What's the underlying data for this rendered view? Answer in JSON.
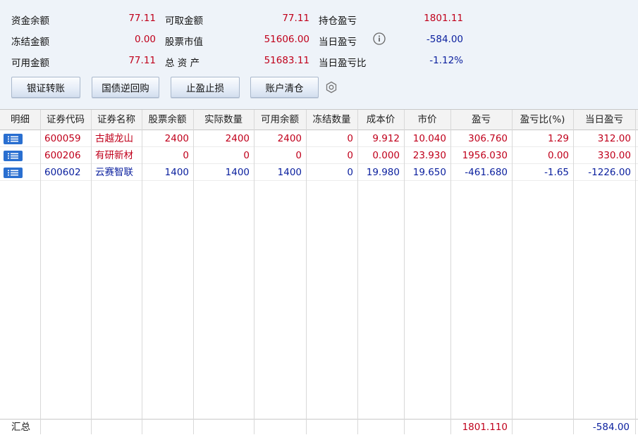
{
  "summary": {
    "balance_label": "资金余额",
    "balance_value": "77.11",
    "withdrawable_label": "可取金额",
    "withdrawable_value": "77.11",
    "position_pnl_label": "持仓盈亏",
    "position_pnl_value": "1801.11",
    "frozen_label": "冻结金额",
    "frozen_value": "0.00",
    "market_value_label": "股票市值",
    "market_value_value": "51606.00",
    "today_pnl_label": "当日盈亏",
    "today_pnl_value": "-584.00",
    "available_label": "可用金额",
    "available_value": "77.11",
    "total_assets_label": "总 资 产",
    "total_assets_value": "51683.11",
    "today_pnl_ratio_label": "当日盈亏比",
    "today_pnl_ratio_value": "-1.12%"
  },
  "toolbar": {
    "bank_transfer": "银证转账",
    "repo": "国债逆回购",
    "stop_profit_loss": "止盈止损",
    "clear_account": "账户清仓"
  },
  "icons": {
    "info": "info-icon",
    "settings": "gear-icon",
    "detail": "list-icon"
  },
  "colors": {
    "positive": "#c0001b",
    "negative": "#0a1f9e"
  },
  "table": {
    "headers": [
      "明细",
      "证券代码",
      "证券名称",
      "股票余额",
      "实际数量",
      "可用余额",
      "冻结数量",
      "成本价",
      "市价",
      "盈亏",
      "盈亏比(%)",
      "当日盈亏"
    ],
    "rows": [
      {
        "code": "600059",
        "name": "古越龙山",
        "balance": "2400",
        "actual": "2400",
        "available": "2400",
        "frozen": "0",
        "cost": "9.912",
        "price": "10.040",
        "pnl": "306.760",
        "pnl_ratio": "1.29",
        "today_pnl": "312.00",
        "color": "red"
      },
      {
        "code": "600206",
        "name": "有研新材",
        "balance": "0",
        "actual": "0",
        "available": "0",
        "frozen": "0",
        "cost": "0.000",
        "price": "23.930",
        "pnl": "1956.030",
        "pnl_ratio": "0.00",
        "today_pnl": "330.00",
        "color": "red"
      },
      {
        "code": "600602",
        "name": "云赛智联",
        "balance": "1400",
        "actual": "1400",
        "available": "1400",
        "frozen": "0",
        "cost": "19.980",
        "price": "19.650",
        "pnl": "-461.680",
        "pnl_ratio": "-1.65",
        "today_pnl": "-1226.00",
        "color": "blue"
      }
    ],
    "footer": {
      "label": "汇总",
      "pnl": "1801.110",
      "today_pnl": "-584.00"
    }
  }
}
